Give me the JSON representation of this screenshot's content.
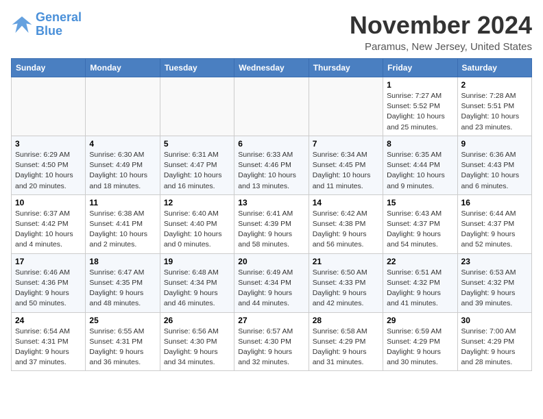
{
  "header": {
    "logo_line1": "General",
    "logo_line2": "Blue",
    "month_title": "November 2024",
    "location": "Paramus, New Jersey, United States"
  },
  "weekdays": [
    "Sunday",
    "Monday",
    "Tuesday",
    "Wednesday",
    "Thursday",
    "Friday",
    "Saturday"
  ],
  "weeks": [
    [
      {
        "day": "",
        "info": ""
      },
      {
        "day": "",
        "info": ""
      },
      {
        "day": "",
        "info": ""
      },
      {
        "day": "",
        "info": ""
      },
      {
        "day": "",
        "info": ""
      },
      {
        "day": "1",
        "info": "Sunrise: 7:27 AM\nSunset: 5:52 PM\nDaylight: 10 hours and 25 minutes."
      },
      {
        "day": "2",
        "info": "Sunrise: 7:28 AM\nSunset: 5:51 PM\nDaylight: 10 hours and 23 minutes."
      }
    ],
    [
      {
        "day": "3",
        "info": "Sunrise: 6:29 AM\nSunset: 4:50 PM\nDaylight: 10 hours and 20 minutes."
      },
      {
        "day": "4",
        "info": "Sunrise: 6:30 AM\nSunset: 4:49 PM\nDaylight: 10 hours and 18 minutes."
      },
      {
        "day": "5",
        "info": "Sunrise: 6:31 AM\nSunset: 4:47 PM\nDaylight: 10 hours and 16 minutes."
      },
      {
        "day": "6",
        "info": "Sunrise: 6:33 AM\nSunset: 4:46 PM\nDaylight: 10 hours and 13 minutes."
      },
      {
        "day": "7",
        "info": "Sunrise: 6:34 AM\nSunset: 4:45 PM\nDaylight: 10 hours and 11 minutes."
      },
      {
        "day": "8",
        "info": "Sunrise: 6:35 AM\nSunset: 4:44 PM\nDaylight: 10 hours and 9 minutes."
      },
      {
        "day": "9",
        "info": "Sunrise: 6:36 AM\nSunset: 4:43 PM\nDaylight: 10 hours and 6 minutes."
      }
    ],
    [
      {
        "day": "10",
        "info": "Sunrise: 6:37 AM\nSunset: 4:42 PM\nDaylight: 10 hours and 4 minutes."
      },
      {
        "day": "11",
        "info": "Sunrise: 6:38 AM\nSunset: 4:41 PM\nDaylight: 10 hours and 2 minutes."
      },
      {
        "day": "12",
        "info": "Sunrise: 6:40 AM\nSunset: 4:40 PM\nDaylight: 10 hours and 0 minutes."
      },
      {
        "day": "13",
        "info": "Sunrise: 6:41 AM\nSunset: 4:39 PM\nDaylight: 9 hours and 58 minutes."
      },
      {
        "day": "14",
        "info": "Sunrise: 6:42 AM\nSunset: 4:38 PM\nDaylight: 9 hours and 56 minutes."
      },
      {
        "day": "15",
        "info": "Sunrise: 6:43 AM\nSunset: 4:37 PM\nDaylight: 9 hours and 54 minutes."
      },
      {
        "day": "16",
        "info": "Sunrise: 6:44 AM\nSunset: 4:37 PM\nDaylight: 9 hours and 52 minutes."
      }
    ],
    [
      {
        "day": "17",
        "info": "Sunrise: 6:46 AM\nSunset: 4:36 PM\nDaylight: 9 hours and 50 minutes."
      },
      {
        "day": "18",
        "info": "Sunrise: 6:47 AM\nSunset: 4:35 PM\nDaylight: 9 hours and 48 minutes."
      },
      {
        "day": "19",
        "info": "Sunrise: 6:48 AM\nSunset: 4:34 PM\nDaylight: 9 hours and 46 minutes."
      },
      {
        "day": "20",
        "info": "Sunrise: 6:49 AM\nSunset: 4:34 PM\nDaylight: 9 hours and 44 minutes."
      },
      {
        "day": "21",
        "info": "Sunrise: 6:50 AM\nSunset: 4:33 PM\nDaylight: 9 hours and 42 minutes."
      },
      {
        "day": "22",
        "info": "Sunrise: 6:51 AM\nSunset: 4:32 PM\nDaylight: 9 hours and 41 minutes."
      },
      {
        "day": "23",
        "info": "Sunrise: 6:53 AM\nSunset: 4:32 PM\nDaylight: 9 hours and 39 minutes."
      }
    ],
    [
      {
        "day": "24",
        "info": "Sunrise: 6:54 AM\nSunset: 4:31 PM\nDaylight: 9 hours and 37 minutes."
      },
      {
        "day": "25",
        "info": "Sunrise: 6:55 AM\nSunset: 4:31 PM\nDaylight: 9 hours and 36 minutes."
      },
      {
        "day": "26",
        "info": "Sunrise: 6:56 AM\nSunset: 4:30 PM\nDaylight: 9 hours and 34 minutes."
      },
      {
        "day": "27",
        "info": "Sunrise: 6:57 AM\nSunset: 4:30 PM\nDaylight: 9 hours and 32 minutes."
      },
      {
        "day": "28",
        "info": "Sunrise: 6:58 AM\nSunset: 4:29 PM\nDaylight: 9 hours and 31 minutes."
      },
      {
        "day": "29",
        "info": "Sunrise: 6:59 AM\nSunset: 4:29 PM\nDaylight: 9 hours and 30 minutes."
      },
      {
        "day": "30",
        "info": "Sunrise: 7:00 AM\nSunset: 4:29 PM\nDaylight: 9 hours and 28 minutes."
      }
    ]
  ]
}
